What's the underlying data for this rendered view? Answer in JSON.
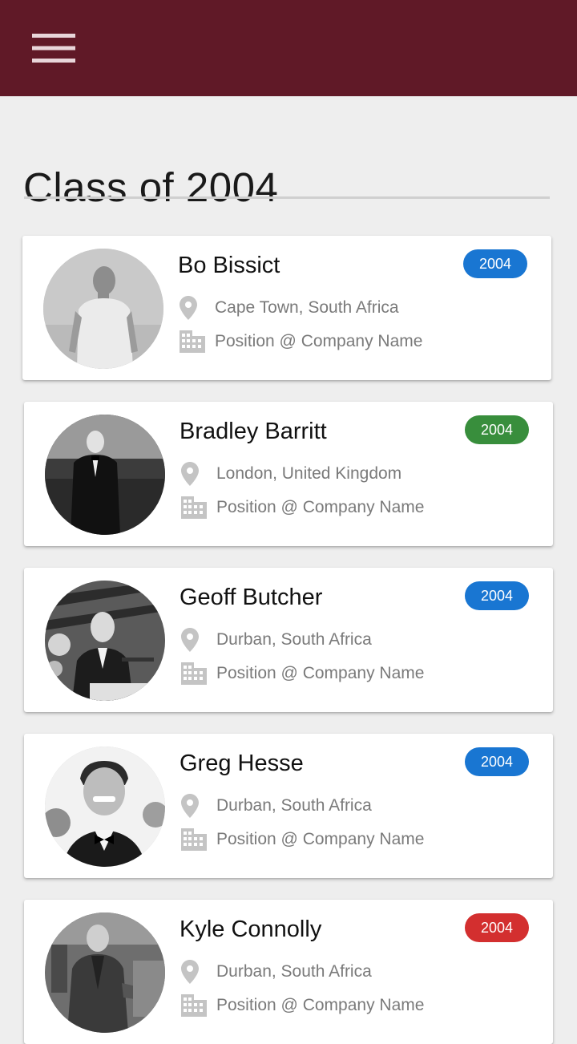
{
  "app": {
    "menu_icon": "hamburger-menu-icon",
    "bar_color": "#601927"
  },
  "page": {
    "title": "Class of 2004"
  },
  "people": [
    {
      "name": "Bo Bissict",
      "location": "Cape Town, South Africa",
      "position": "Position @ Company Name",
      "year": "2004",
      "badge_color": "#1976d2"
    },
    {
      "name": "Bradley Barritt",
      "location": "London, United Kingdom",
      "position": "Position @ Company Name",
      "year": "2004",
      "badge_color": "#388e3c"
    },
    {
      "name": "Geoff Butcher",
      "location": "Durban, South Africa",
      "position": "Position @ Company Name",
      "year": "2004",
      "badge_color": "#1976d2"
    },
    {
      "name": "Greg Hesse",
      "location": "Durban, South Africa",
      "position": "Position @ Company Name",
      "year": "2004",
      "badge_color": "#1976d2"
    },
    {
      "name": "Kyle Connolly",
      "location": "Durban, South Africa",
      "position": "Position @ Company Name",
      "year": "2004",
      "badge_color": "#d32f2f"
    }
  ],
  "icons": {
    "location": "location-pin-icon",
    "company": "building-icon"
  }
}
